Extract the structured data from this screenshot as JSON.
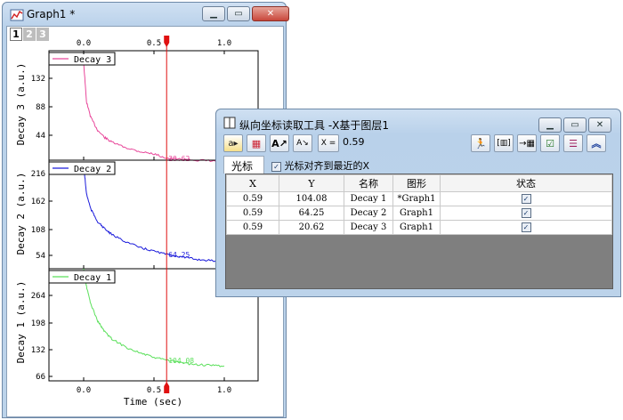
{
  "graph_window": {
    "title": "Graph1 *",
    "layer_tabs": [
      "1",
      "2",
      "3"
    ],
    "active_layer": "1"
  },
  "chart_data": [
    {
      "type": "line",
      "ylabel": "Decay 3 (a.u.)",
      "legend": "Decay 3",
      "color": "#e8479a",
      "y_ticks": [
        "44",
        "88",
        "132"
      ],
      "ylim": [
        20,
        160
      ],
      "cursor_label": "20.62",
      "series": [
        {
          "name": "Decay 3",
          "x": [
            0.0,
            0.02,
            0.05,
            0.1,
            0.15,
            0.2,
            0.3,
            0.4,
            0.5,
            0.6,
            0.7,
            0.8,
            0.9,
            1.0
          ],
          "y": [
            145,
            95,
            75,
            58,
            49,
            43,
            36,
            31,
            28,
            22,
            21,
            20,
            19,
            18
          ]
        }
      ]
    },
    {
      "type": "line",
      "ylabel": "Decay 2 (a.u.)",
      "legend": "Decay 2",
      "color": "#1a1adb",
      "y_ticks": [
        "54",
        "108",
        "162",
        "216"
      ],
      "ylim": [
        40,
        225
      ],
      "cursor_label": "64.25",
      "series": [
        {
          "name": "Decay 2",
          "x": [
            0.0,
            0.02,
            0.05,
            0.1,
            0.15,
            0.2,
            0.3,
            0.4,
            0.5,
            0.6,
            0.7,
            0.8,
            0.9,
            1.0
          ],
          "y": [
            216,
            168,
            142,
            120,
            108,
            98,
            86,
            76,
            70,
            64,
            60,
            56,
            54,
            52
          ]
        }
      ]
    },
    {
      "type": "line",
      "ylabel": "Decay 1 (a.u.)",
      "legend": "Decay 1",
      "color": "#5be05b",
      "y_ticks": [
        "66",
        "132",
        "198",
        "264"
      ],
      "ylim": [
        60,
        300
      ],
      "cursor_label": "104.08",
      "x_ticks": [
        "0.0",
        "0.5",
        "1.0"
      ],
      "xlabel": "Time (sec)",
      "series": [
        {
          "name": "Decay 1",
          "x": [
            0.0,
            0.02,
            0.05,
            0.1,
            0.15,
            0.2,
            0.3,
            0.4,
            0.5,
            0.6,
            0.7,
            0.8,
            0.9,
            1.0
          ],
          "y": [
            300,
            262,
            225,
            188,
            165,
            150,
            132,
            120,
            110,
            104,
            98,
            95,
            93,
            92
          ]
        }
      ]
    }
  ],
  "top_axis_ticks": [
    "0.0",
    "0.5",
    "1.0"
  ],
  "cursor_x": 0.59,
  "tool_window": {
    "title": "纵向坐标读取工具 -X基于图层1",
    "x_label": "X =",
    "x_value": "0.59",
    "tab_label": "光标",
    "snap_label": "光标对齐到最近的X",
    "columns": [
      "X",
      "Y",
      "名称",
      "图形",
      "状态"
    ],
    "rows": [
      {
        "x": "0.59",
        "y": "104.08",
        "name": "Decay 1",
        "graph": "*Graph1"
      },
      {
        "x": "0.59",
        "y": "64.25",
        "name": "Decay 2",
        "graph": "Graph1"
      },
      {
        "x": "0.59",
        "y": "20.62",
        "name": "Decay 3",
        "graph": "Graph1"
      }
    ]
  }
}
